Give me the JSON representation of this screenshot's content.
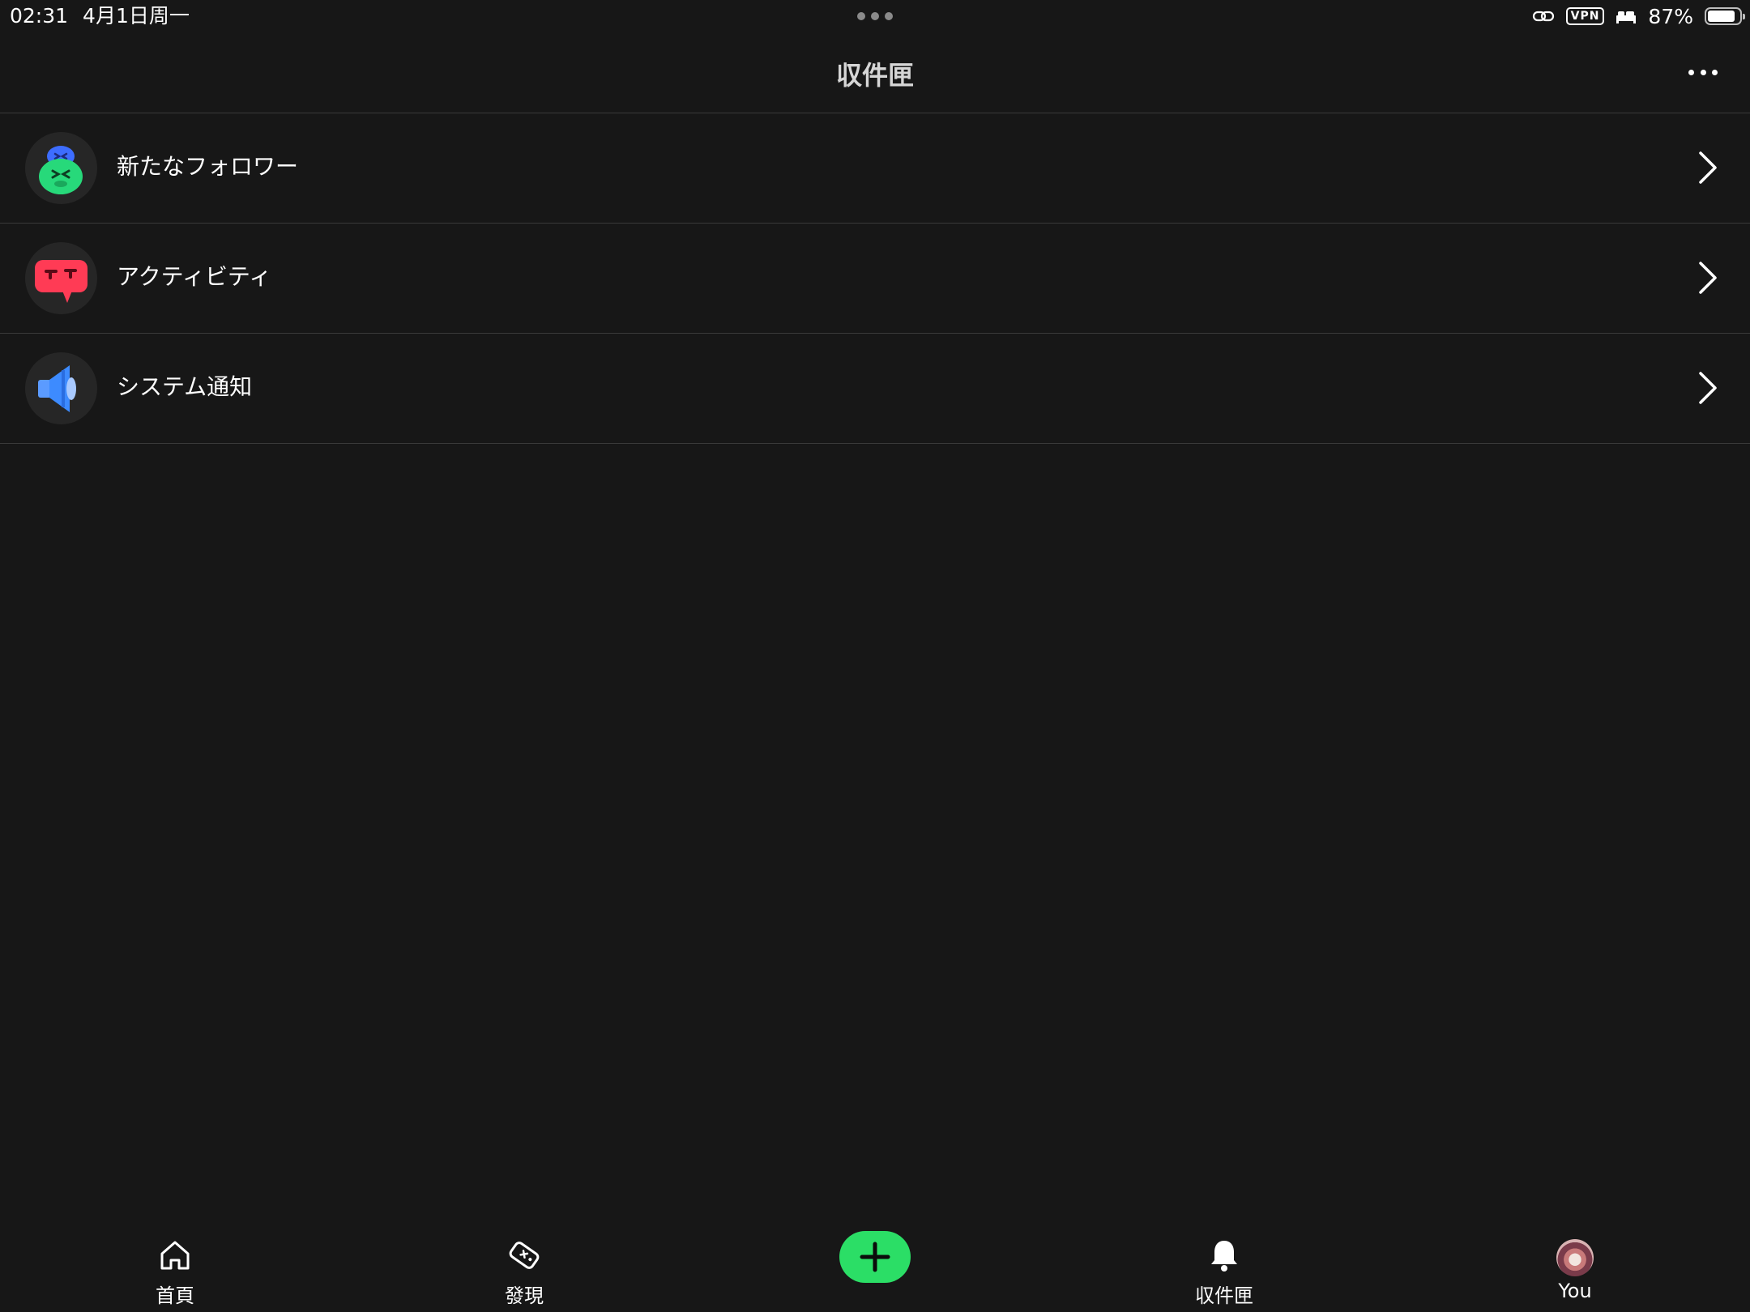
{
  "status_bar": {
    "time": "02:31",
    "date": "4月1日周一",
    "vpn": "VPN",
    "battery_percent": "87%",
    "battery_level": 0.87
  },
  "header": {
    "title": "収件匣"
  },
  "inbox": {
    "items": [
      {
        "label": "新たなフォロワー",
        "icon": "followers-mascot-icon"
      },
      {
        "label": "アクティビティ",
        "icon": "activity-chat-bubble-icon"
      },
      {
        "label": "システム通知",
        "icon": "megaphone-icon"
      }
    ]
  },
  "tab_bar": {
    "home": "首頁",
    "discover": "發現",
    "create": "+",
    "inbox": "収件匣",
    "profile": "You"
  },
  "colors": {
    "background": "#171717",
    "divider": "#3a3a3a",
    "accent_green": "#2bde66",
    "activity_red": "#ff3b55",
    "notice_blue": "#3d8bff"
  }
}
